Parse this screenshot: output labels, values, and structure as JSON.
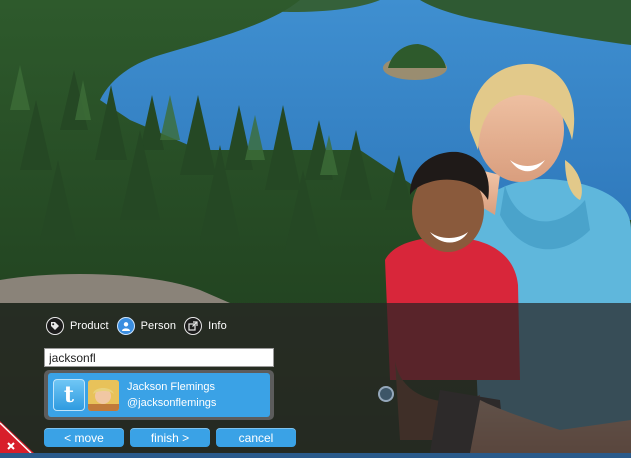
{
  "tag_types": {
    "product_label": "Product",
    "person_label": "Person",
    "info_label": "Info",
    "active": "person"
  },
  "search": {
    "value": "jacksonfl"
  },
  "results": [
    {
      "source_icon": "twitter-icon",
      "name": "Jackson Flemings",
      "handle": "@jacksonflemings"
    }
  ],
  "actions": {
    "move_label": "< move",
    "finish_label": "finish >",
    "cancel_label": "cancel"
  },
  "close_icon": "close-icon",
  "colors": {
    "accent": "#3aa2e6",
    "overlay": "#282424",
    "close_corner": "#d81e2a"
  }
}
